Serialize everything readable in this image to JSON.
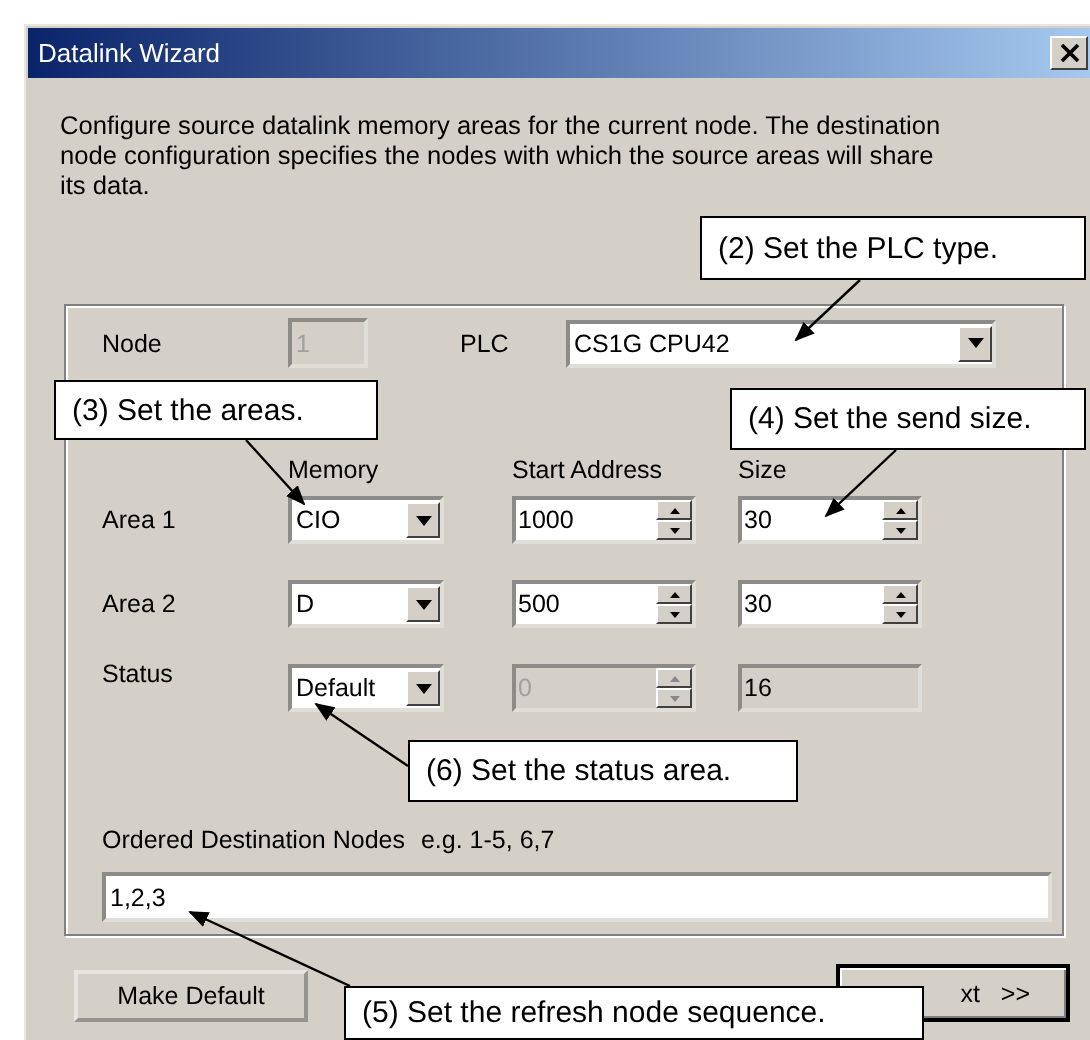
{
  "window": {
    "title": "Datalink Wizard"
  },
  "description": "Configure source datalink memory areas for the current node. The destination node configuration specifies the nodes with which the source areas will share its data.",
  "node": {
    "label": "Node",
    "value": "1",
    "disabled": true
  },
  "plc": {
    "label": "PLC",
    "value": "CS1G CPU42"
  },
  "columns": [
    "Memory",
    "Start Address",
    "Size"
  ],
  "areas": [
    {
      "label": "Area 1",
      "memory": "CIO",
      "start_address": {
        "value": "1000",
        "disabled": false
      },
      "size": {
        "value": "30",
        "kind": "spin"
      }
    },
    {
      "label": "Area 2",
      "memory": "D",
      "start_address": {
        "value": "500",
        "disabled": false
      },
      "size": {
        "value": "30",
        "kind": "spin"
      }
    },
    {
      "label": "Status",
      "memory": "Default",
      "start_address": {
        "value": "0",
        "disabled": true
      },
      "size": {
        "value": "16",
        "kind": "readonly"
      }
    }
  ],
  "destination": {
    "label": "Ordered Destination Nodes",
    "hint": "e.g. 1-5, 6,7",
    "value": "1,2,3"
  },
  "buttons": [
    {
      "label": "Make Default",
      "kind": "plain"
    },
    {
      "label": "xt   >>",
      "kind": "default"
    }
  ],
  "callouts": [
    "(2) Set the PLC type.",
    "(3) Set the areas.",
    "(4) Set the send size.",
    "(6) Set the status area.",
    "(5) Set the refresh node sequence."
  ]
}
